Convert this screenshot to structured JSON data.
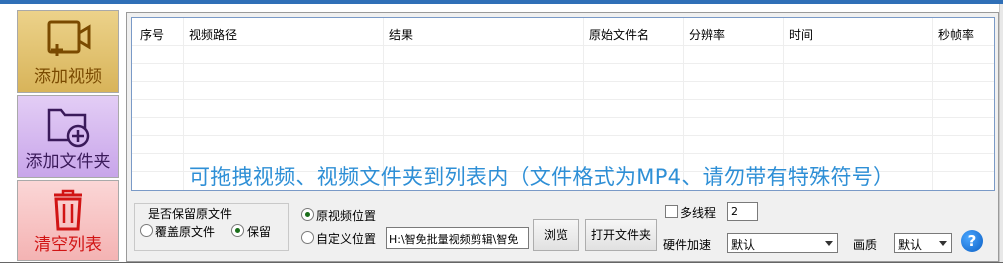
{
  "sidebar": {
    "add_video": "添加视频",
    "add_folder": "添加文件夹",
    "clear_list": "清空列表"
  },
  "table": {
    "columns": [
      "序号",
      "视频路径",
      "结果",
      "原始文件名",
      "分辨率",
      "时间",
      "秒帧率"
    ],
    "rows": []
  },
  "drop_hint": "可拖拽视频、视频文件夹到列表内（文件格式为MP4、请勿带有特殊符号）",
  "keep_original": {
    "title": "是否保留原文件",
    "overwrite_label": "覆盖原文件",
    "keep_label": "保留",
    "selected": "保留"
  },
  "output_location": {
    "original_label": "原视频位置",
    "custom_label": "自定义位置",
    "selected": "原视频位置",
    "path": "H:\\智免批量视频剪辑\\智免"
  },
  "buttons": {
    "browse": "浏览",
    "open_folder": "打开文件夹"
  },
  "threads": {
    "label": "多线程",
    "checked": false,
    "value": "2"
  },
  "hardware_accel": {
    "label": "硬件加速",
    "value": "默认"
  },
  "quality": {
    "label": "画质",
    "value": "默认"
  },
  "help": "?",
  "colors": {
    "hint": "#2e8fd6",
    "clear_label": "#d11414",
    "add_video_bg": "#e3c375",
    "add_folder_bg": "#d6b9f0",
    "clear_bg": "#f7c4c4"
  }
}
